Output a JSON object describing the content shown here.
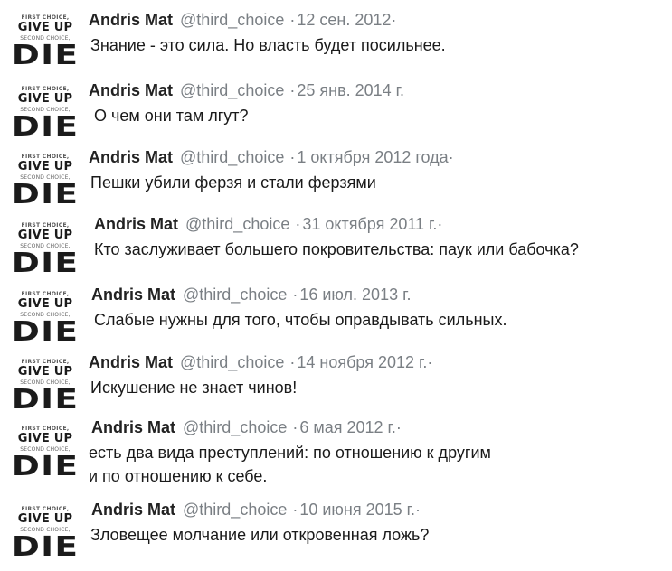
{
  "tweets": [
    {
      "name": "Andris Mat",
      "handle": "@third_choice",
      "sep": "·",
      "date": "12 сен. 2012·",
      "lines": [
        "Знание - это сила. Но власть будет посильнее."
      ]
    },
    {
      "name": "Andris Mat",
      "handle": "@third_choice",
      "sep": "·",
      "date": "25 янв. 2014 г.",
      "lines": [
        "О чем они там лгут?"
      ]
    },
    {
      "name": "Andris Mat",
      "handle": "@third_choice",
      "sep": "·",
      "date": "1 октября 2012 года·",
      "lines": [
        "Пешки убили ферзя и стали ферзями"
      ]
    },
    {
      "name": "Andris Mat",
      "handle": "@third_choice",
      "sep": "·",
      "date": "31 октября 2011 г.·",
      "lines": [
        "Кто заслуживает большего покровительства: паук или бабочка?"
      ]
    },
    {
      "name": "Andris Mat",
      "handle": "@third_choice",
      "sep": "·",
      "date": "16 июл. 2013 г.",
      "lines": [
        "Слабые нужны для того, чтобы оправдывать сильных."
      ]
    },
    {
      "name": "Andris Mat",
      "handle": "@third_choice",
      "sep": "·",
      "date": "14 ноября 2012 г.·",
      "lines": [
        "Искушение не знает чинов!"
      ]
    },
    {
      "name": "Andris Mat",
      "handle": "@third_choice",
      "sep": "·",
      "date": "6 мая 2012 г.·",
      "lines": [
        "есть два вида преступлений: по отношению к другим",
        "и по отношению к себе."
      ]
    },
    {
      "name": "Andris Mat",
      "handle": "@third_choice",
      "sep": "·",
      "date": "10 июня 2015 г.·",
      "lines": [
        "Зловещее молчание или откровенная ложь?"
      ]
    }
  ],
  "avatar": {
    "first": "FIRST CHOICE,",
    "giveup": "GIVE UP",
    "second": "SECOND CHOICE,",
    "die": "DIE"
  }
}
